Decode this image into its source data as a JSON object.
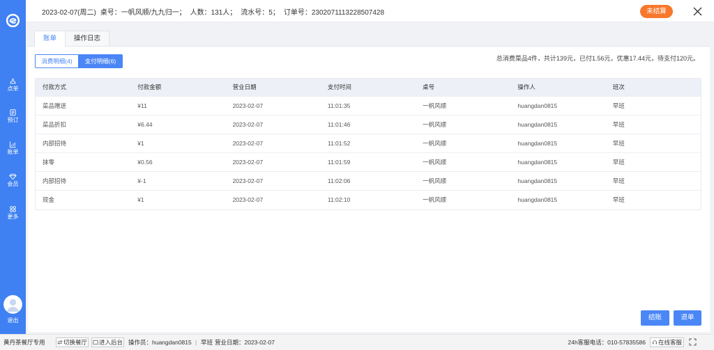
{
  "colors": {
    "sidebar": "#3f80f3",
    "accent": "#4a86f6",
    "status_badge": "#f7782c",
    "table_header": "#edf0f6",
    "page_background": "#f0f2f5"
  },
  "sidebar": {
    "logo_icon": "brand-logo-icon",
    "items": [
      {
        "label": "点单",
        "icon": "service-bell-icon"
      },
      {
        "label": "预订",
        "icon": "calendar-icon"
      },
      {
        "label": "账单",
        "icon": "chart-icon"
      },
      {
        "label": "会员",
        "icon": "diamond-icon"
      },
      {
        "label": "更多",
        "icon": "grid-icon"
      }
    ],
    "avatar_icon": "user-avatar-icon",
    "logout_label": "退出"
  },
  "header": {
    "date": "2023-02-07(周二)",
    "table_no": "桌号：一帆风顺/九九归一；",
    "guests": "人数：131人；",
    "serial_no": "流水号：5；",
    "order_no": "订单号：2302071113228507428",
    "status_badge": "未结算",
    "close_icon": "close-icon"
  },
  "tabs": [
    {
      "label": "账单",
      "active": true
    },
    {
      "label": "操作日志",
      "active": false
    }
  ],
  "detail_toggle": [
    {
      "label": "消费明细(4)",
      "active": false
    },
    {
      "label": "支付明细(6)",
      "active": true
    }
  ],
  "summary": "总消费菜品4件，共计139元，已付1.56元，优惠17.44元，待支付120元。",
  "payments_table": {
    "columns": [
      {
        "key": "method",
        "label": "付款方式"
      },
      {
        "key": "amount",
        "label": "付款金额"
      },
      {
        "key": "business_date",
        "label": "营业日期"
      },
      {
        "key": "pay_time",
        "label": "支付时间"
      },
      {
        "key": "table",
        "label": "桌号"
      },
      {
        "key": "operator",
        "label": "操作人"
      },
      {
        "key": "shift",
        "label": "班次"
      }
    ],
    "rows": [
      {
        "method": "菜品赠送",
        "amount": "¥11",
        "business_date": "2023-02-07",
        "pay_time": "11:01:35",
        "table": "一帆风顺",
        "operator": "huangdan0815",
        "shift": "早班"
      },
      {
        "method": "菜品折扣",
        "amount": "¥6.44",
        "business_date": "2023-02-07",
        "pay_time": "11:01:46",
        "table": "一帆风顺",
        "operator": "huangdan0815",
        "shift": "早班"
      },
      {
        "method": "内部招待",
        "amount": "¥1",
        "business_date": "2023-02-07",
        "pay_time": "11:01:52",
        "table": "一帆风顺",
        "operator": "huangdan0815",
        "shift": "早班"
      },
      {
        "method": "抹零",
        "amount": "¥0.56",
        "business_date": "2023-02-07",
        "pay_time": "11:01:59",
        "table": "一帆风顺",
        "operator": "huangdan0815",
        "shift": "早班"
      },
      {
        "method": "内部招待",
        "amount": "¥-1",
        "business_date": "2023-02-07",
        "pay_time": "11:02:06",
        "table": "一帆风顺",
        "operator": "huangdan0815",
        "shift": "早班"
      },
      {
        "method": "现金",
        "amount": "¥1",
        "business_date": "2023-02-07",
        "pay_time": "11:02:10",
        "table": "一帆风顺",
        "operator": "huangdan0815",
        "shift": "早班"
      }
    ]
  },
  "actions": {
    "checkout_label": "结账",
    "refund_label": "退单"
  },
  "footer": {
    "restaurant": "黄丹茶餐厅专用",
    "switch_icon": "switch-icon",
    "switch_label": "切换餐厅",
    "backend_icon": "window-icon",
    "backend_label": "进入后台",
    "operator": "操作员：huangdan0815",
    "divider": "|",
    "shift": "早班",
    "business_date": "营业日期：2023-02-07",
    "hotline": "24h客服电话：010-57835586",
    "support_icon": "headset-icon",
    "support_label": "在线客服",
    "fullscreen_icon": "fullscreen-icon"
  }
}
